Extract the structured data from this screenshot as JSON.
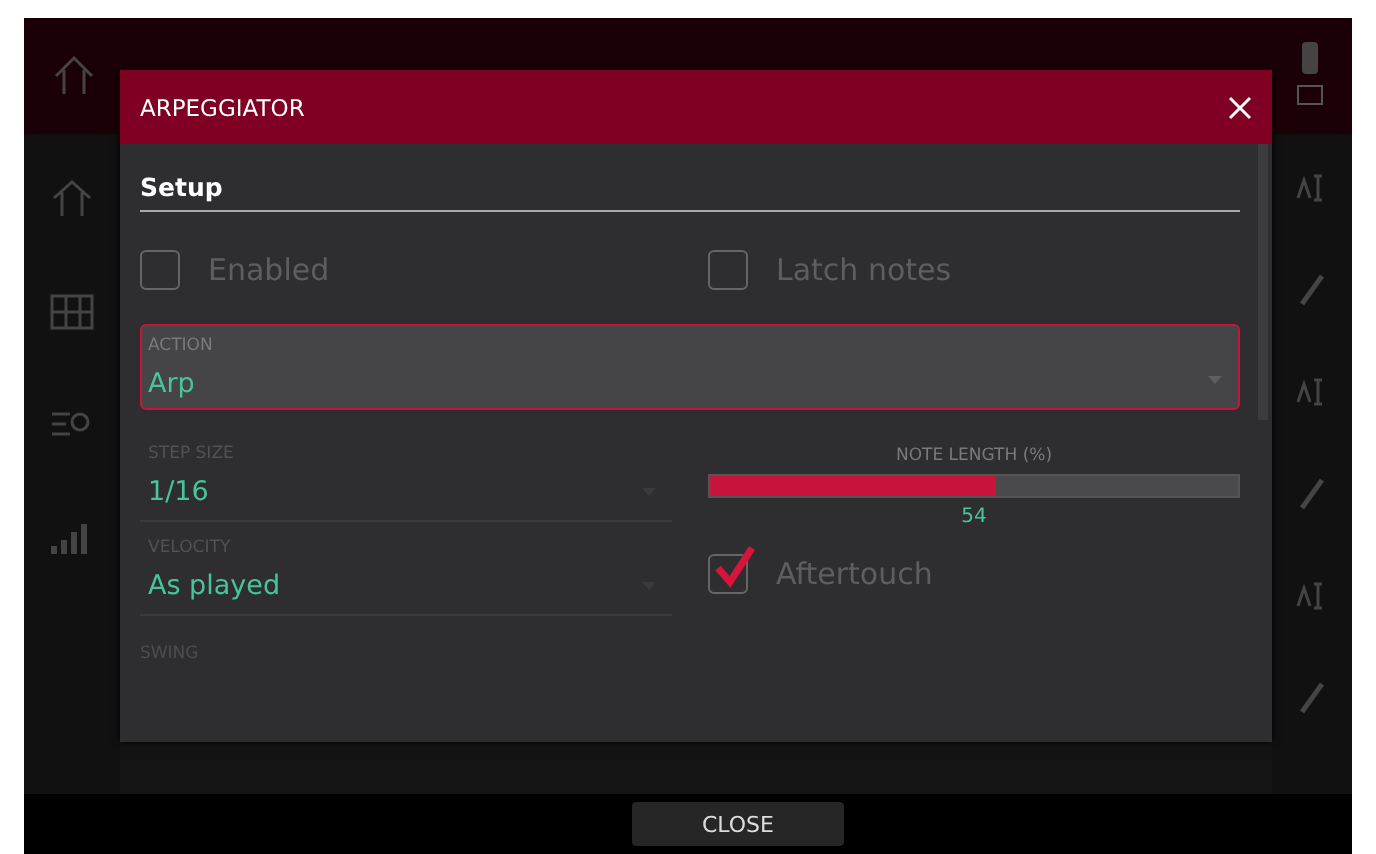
{
  "dialog": {
    "title": "ARPEGGIATOR",
    "section": "Setup",
    "checkboxes": [
      {
        "label": "Enabled",
        "checked": false
      },
      {
        "label": "Latch notes",
        "checked": false
      }
    ],
    "action": {
      "label": "ACTION",
      "value": "Arp",
      "focused": true
    },
    "step_size": {
      "label": "STEP SIZE",
      "value": "1/16",
      "focused": false
    },
    "note_length": {
      "label": "NOTE LENGTH (%)",
      "level": 0.54,
      "reading": "54"
    },
    "velocity": {
      "label": "VELOCITY",
      "value": "As played",
      "focused": false
    },
    "aftertouch": {
      "label": "Aftertouch",
      "checked": true
    },
    "swing": {
      "label": "SWING"
    }
  },
  "close_button": "CLOSE"
}
